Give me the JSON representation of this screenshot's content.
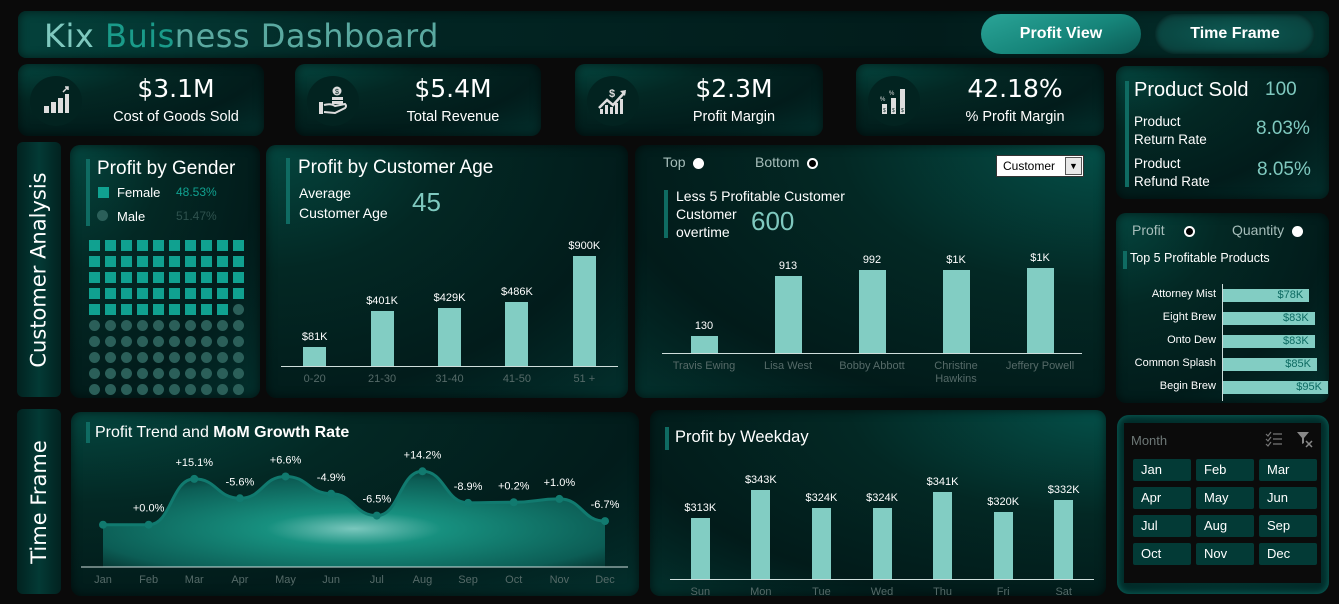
{
  "header": {
    "title_parts": [
      "Kix ",
      "Buis",
      "ness Dashboard"
    ],
    "buttons": {
      "profit_view": "Profit View",
      "time_frame": "Time Frame"
    }
  },
  "kpis": [
    {
      "value": "$3.1M",
      "label": "Cost of Goods Sold",
      "icon": "bar-growth-icon"
    },
    {
      "value": "$5.4M",
      "label": "Total Revenue",
      "icon": "hand-coins-icon"
    },
    {
      "value": "$2.3M",
      "label": "Profit  Margin",
      "icon": "dollar-trend-icon"
    },
    {
      "value": "42.18%",
      "label": "% Profit Margin",
      "icon": "percent-bars-icon"
    }
  ],
  "product_summary": {
    "sold_label": "Product Sold",
    "sold_value": "100",
    "return_label_1": "Product",
    "return_label_2": "Return Rate",
    "return_value": "8.03%",
    "refund_label_1": "Product",
    "refund_label_2": "Refund Rate",
    "refund_value": "8.05%"
  },
  "side_labels": {
    "customer": "Customer Analysis",
    "time": "Time Frame"
  },
  "gender": {
    "title": "Profit by Gender",
    "female_label": "Female",
    "female_pct": "48.53%",
    "male_label": "Male",
    "male_pct": "51.47%",
    "female_cells": 49,
    "total_cells": 100,
    "accent_female": "#10a190",
    "accent_male": "#2b5f59"
  },
  "age": {
    "title": "Profit by Customer Age",
    "avg_label_1": "Average",
    "avg_label_2": "Customer Age",
    "avg_value": "45"
  },
  "customers": {
    "top_label": "Top",
    "bottom_label": "Bottom",
    "selected": "Bottom",
    "dropdown_value": "Customer",
    "title": "Less 5 Profitable Customer",
    "count_label_1": "Customer",
    "count_label_2": "overtime",
    "count_value": "600"
  },
  "products": {
    "profit_label": "Profit",
    "quantity_label": "Quantity",
    "selected": "Profit",
    "title": "Top 5 Profitable Products"
  },
  "trend": {
    "title_normal": "Profit Trend and ",
    "title_bold": "MoM Growth Rate"
  },
  "weekday": {
    "title": "Profit by Weekday"
  },
  "slicer": {
    "title": "Month",
    "months": [
      "Jan",
      "Feb",
      "Mar",
      "Apr",
      "May",
      "Jun",
      "Jul",
      "Aug",
      "Sep",
      "Oct",
      "Nov",
      "Dec"
    ]
  },
  "chart_data": [
    {
      "id": "age",
      "type": "bar",
      "title": "Profit by Customer Age",
      "categories": [
        "0-20",
        "21-30",
        "31-40",
        "41-50",
        "51 +"
      ],
      "values": [
        81,
        401,
        429,
        486,
        900
      ],
      "labels": [
        "$81K",
        "$401K",
        "$429K",
        "$486K",
        "$900K"
      ],
      "unit": "$K",
      "ylim": [
        0,
        900
      ]
    },
    {
      "id": "customers",
      "type": "bar",
      "title": "Less 5 Profitable Customer",
      "categories": [
        "Travis Ewing",
        "Lisa West",
        "Bobby Abbott",
        "Christine Hawkins",
        "Jeffery Powell"
      ],
      "values": [
        130,
        913,
        992,
        1000,
        1020
      ],
      "labels": [
        "130",
        "913",
        "992",
        "$1K",
        "$1K"
      ],
      "ylim": [
        0,
        1020
      ]
    },
    {
      "id": "products",
      "type": "bar",
      "orientation": "horizontal",
      "title": "Top 5 Profitable Products",
      "categories": [
        "Attorney Mist",
        "Eight Brew",
        "Onto Dew",
        "Common Splash",
        "Begin Brew"
      ],
      "values": [
        78,
        83,
        83,
        85,
        95
      ],
      "labels": [
        "$78K",
        "$83K",
        "$83K",
        "$85K",
        "$95K"
      ],
      "unit": "$K",
      "xlim": [
        0,
        95
      ]
    },
    {
      "id": "trend",
      "type": "area",
      "title": "Profit Trend and MoM Growth Rate",
      "categories": [
        "Jan",
        "Feb",
        "Mar",
        "Apr",
        "May",
        "Jun",
        "Jul",
        "Aug",
        "Sep",
        "Oct",
        "Nov",
        "Dec"
      ],
      "relative_values": [
        100,
        100.0,
        115.1,
        108.7,
        115.9,
        110.2,
        103.0,
        117.6,
        107.2,
        107.4,
        108.5,
        101.2
      ],
      "labels": [
        "",
        "+0.0%",
        "+15.1%",
        "-5.6%",
        "+6.6%",
        "-4.9%",
        "-6.5%",
        "+14.2%",
        "-8.9%",
        "+0.2%",
        "+1.0%",
        "-6.7%"
      ]
    },
    {
      "id": "weekday",
      "type": "bar",
      "title": "Profit by Weekday",
      "categories": [
        "Sun",
        "Mon",
        "Tue",
        "Wed",
        "Thu",
        "Fri",
        "Sat"
      ],
      "values": [
        313,
        343,
        324,
        324,
        341,
        320,
        332
      ],
      "labels": [
        "$313K",
        "$343K",
        "$324K",
        "$324K",
        "$341K",
        "$320K",
        "$332K"
      ],
      "unit": "$K",
      "ylim": [
        290,
        343
      ]
    }
  ]
}
